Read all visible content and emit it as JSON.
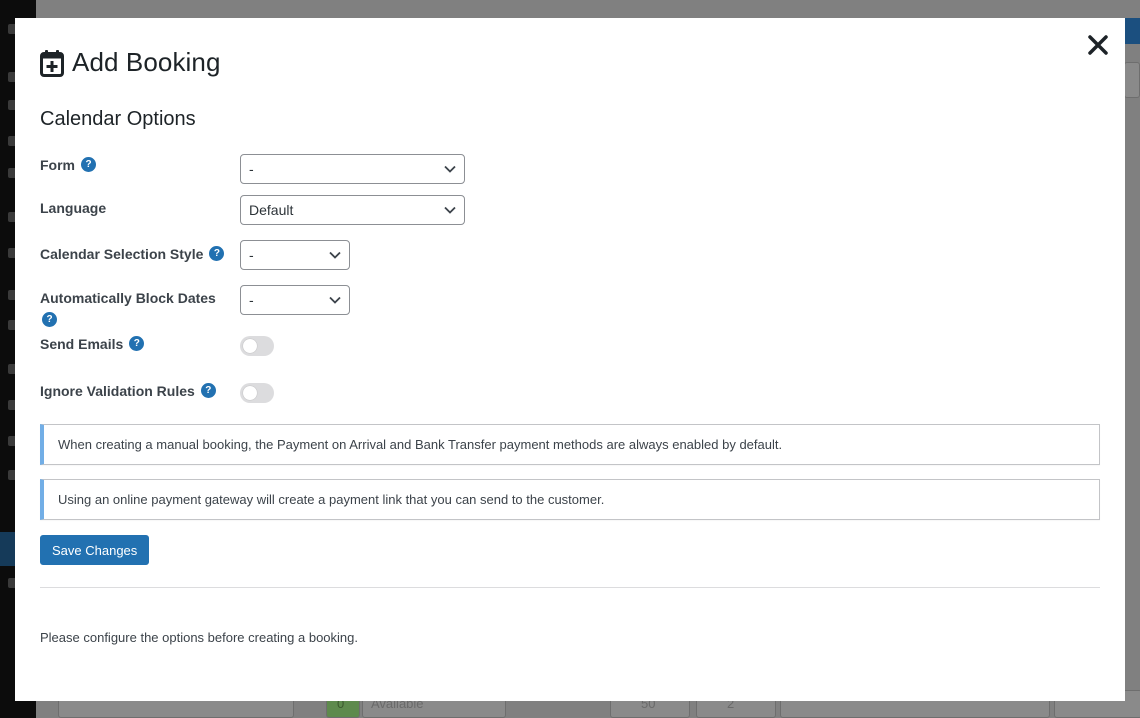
{
  "modal": {
    "title": "Add Booking",
    "section_title": "Calendar Options",
    "close_label": "✕"
  },
  "fields": {
    "form": {
      "label": "Form",
      "value": "-",
      "help": "?"
    },
    "language": {
      "label": "Language",
      "value": "Default"
    },
    "selection_style": {
      "label": "Calendar Selection Style",
      "value": "-",
      "help": "?"
    },
    "block_dates": {
      "label": "Automatically Block Dates",
      "value": "-",
      "help": "?"
    },
    "send_emails": {
      "label": "Send Emails",
      "help": "?",
      "enabled": false
    },
    "ignore_validation": {
      "label": "Ignore Validation Rules",
      "help": "?",
      "enabled": false
    }
  },
  "notices": {
    "manual_booking": "When creating a manual booking, the Payment on Arrival and Bank Transfer payment methods are always enabled by default.",
    "online_gateway": "Using an online payment gateway will create a payment link that you can send to the customer."
  },
  "actions": {
    "save_label": "Save Changes"
  },
  "footer": {
    "note": "Please configure the options before creating a booking."
  },
  "background": {
    "status_value": "Available",
    "count_a": "50",
    "count_b": "2",
    "badge": "0"
  },
  "colors": {
    "accent": "#2271b1",
    "notice_border": "#72aee6",
    "toggle_off": "#dcdcde"
  }
}
